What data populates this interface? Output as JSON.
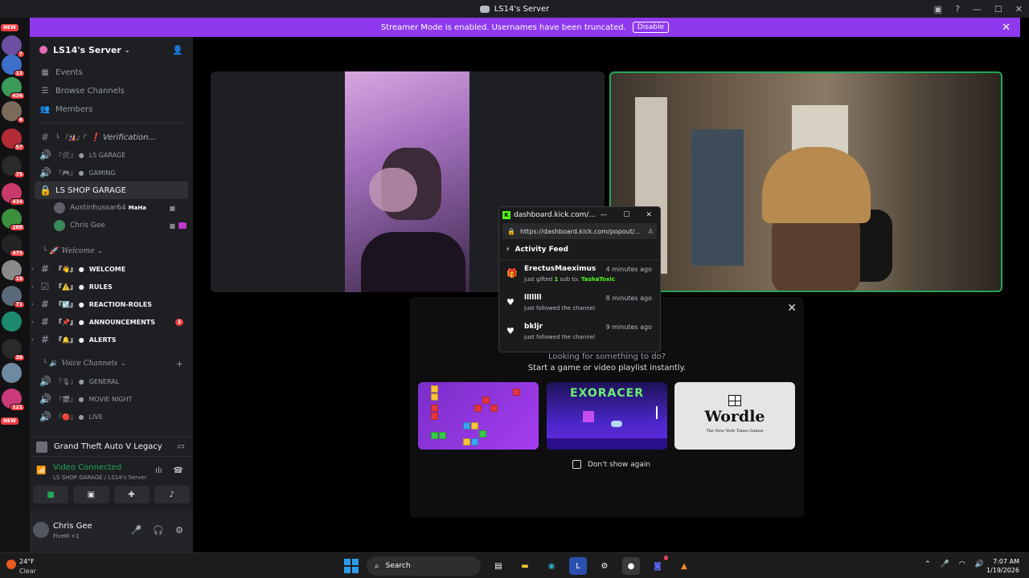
{
  "window": {
    "title": "LS14's Server"
  },
  "banner": {
    "text": "Streamer Mode is enabled. Usernames have been truncated.",
    "disable_label": "Disable"
  },
  "server_rail": {
    "new_label_top": "NEW",
    "new_label_bottom": "NEW",
    "badges": [
      "7",
      "13",
      "436",
      "6",
      "57",
      "75",
      "434",
      "288",
      "475",
      "15",
      "71",
      "36",
      "121"
    ]
  },
  "sidebar": {
    "server_name": "LS14's Server",
    "nav": [
      {
        "label": "Events",
        "icon": "calendar-icon"
      },
      {
        "label": "Browse Channels",
        "icon": "browse-icon"
      },
      {
        "label": "Members",
        "icon": "members-icon"
      }
    ],
    "channels_top": [
      {
        "type": "text",
        "emoji": "╰ 『🎎』『",
        "label": "❗ Verification…",
        "italic": true
      },
      {
        "type": "voice",
        "emoji": "『🛠』 ●",
        "label": "LS GARAGE"
      },
      {
        "type": "voice",
        "emoji": "『🎮』 ●",
        "label": "GAMING"
      }
    ],
    "active_channel": "LS SHOP GARAGE",
    "members": [
      {
        "name": "Austinhussar64",
        "tag": "MaHa"
      },
      {
        "name": "Chris Gee"
      }
    ],
    "welcome_category": "Welcome",
    "welcome_channels": [
      {
        "emoji": "『👋』 ●",
        "label": "WELCOME"
      },
      {
        "emoji": "『⚠️』 ●",
        "label": "RULES"
      },
      {
        "emoji": "『☑️』 ●",
        "label": "REACTION-ROLES"
      },
      {
        "emoji": "『📌』 ●",
        "label": "ANNOUNCEMENTS",
        "mention": "3"
      },
      {
        "emoji": "『🔔』 ●",
        "label": "ALERTS"
      }
    ],
    "voice_category": "Voice Channels",
    "voice_channels": [
      {
        "emoji": "『🎙』 ●",
        "label": "GENERAL"
      },
      {
        "emoji": "『🎬』 ●",
        "label": "MOVIE NIGHT"
      },
      {
        "emoji": "『🔴』 ●",
        "label": "LIVE"
      }
    ],
    "game": "Grand Theft Auto V Legacy",
    "voice": {
      "status": "Video Connected",
      "location": "LS SHOP GARAGE / LS14's Server"
    },
    "user": {
      "name": "Chris Gee",
      "status": "FiveM +1"
    }
  },
  "popout": {
    "title": "dashboard.kick.com/...",
    "url": "https://dashboard.kick.com/popout/...",
    "feed_title": "Activity Feed",
    "items": [
      {
        "who": "ErectusMaeximus",
        "when": "4 minutes ago",
        "pre": "just gifted ",
        "count": "1",
        "mid": " sub to: ",
        "target": "TashaToxic",
        "icon": "gift-icon"
      },
      {
        "who": "lllllll",
        "when": "8 minutes ago",
        "text": "just followed the channel",
        "icon": "heart-icon"
      },
      {
        "who": "bkljr",
        "when": "9 minutes ago",
        "text": "just followed the channel",
        "icon": "heart-icon"
      }
    ]
  },
  "activity_modal": {
    "line1": "Looking for something to do?",
    "line2": "Start a game or video playlist instantly.",
    "exoracer": "EXORACER",
    "wordle": "Wordle",
    "wordle_sub": "The New York Times Games",
    "dont_show": "Don't show again"
  },
  "taskbar": {
    "temp": "24°F",
    "condition": "Clear",
    "search": "Search",
    "discord_badge": "2",
    "time": "7:07 AM",
    "date": "1/19/2026"
  }
}
